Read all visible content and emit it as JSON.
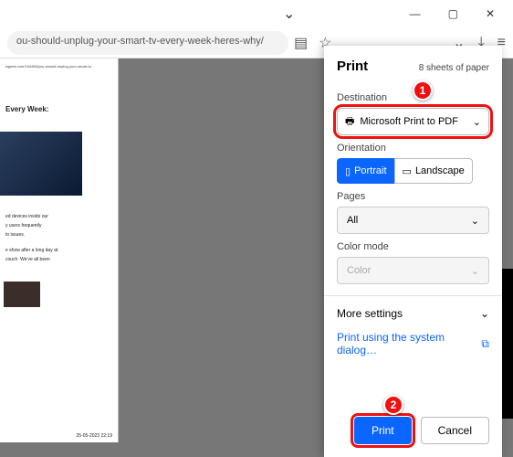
{
  "window": {
    "url_fragment": "ou-should-unplug-your-smart-tv-every-week-heres-why/"
  },
  "preview": {
    "top_text": "wgeek.com/154485/you-should-unplug-your-smart-tv...",
    "heading": "Every Week:",
    "p1": "ed devices inside our",
    "p2": "y users frequently",
    "p3": "to issues.",
    "p4": "e show after a long day at",
    "p5": "couch. We've all been",
    "footer": "25-05-2023  22:19"
  },
  "print": {
    "title": "Print",
    "sheets": "8 sheets of paper",
    "destination_label": "Destination",
    "destination_value": "Microsoft Print to PDF",
    "orientation_label": "Orientation",
    "portrait": "Portrait",
    "landscape": "Landscape",
    "pages_label": "Pages",
    "pages_value": "All",
    "color_label": "Color mode",
    "color_value": "Color",
    "more": "More settings",
    "system_link": "Print using the system dialog…",
    "print_btn": "Print",
    "cancel_btn": "Cancel"
  },
  "callouts": {
    "one": "1",
    "two": "2"
  }
}
